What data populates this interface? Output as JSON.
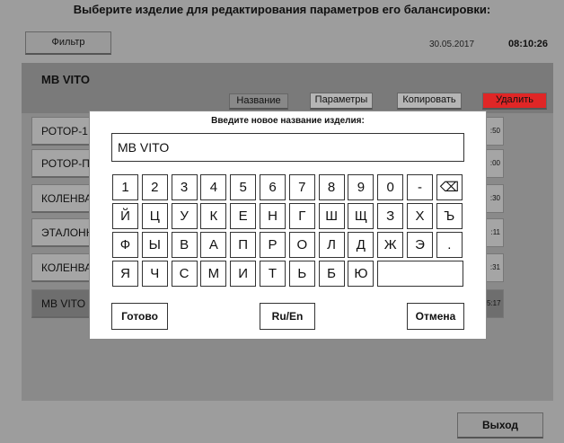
{
  "title": "Выберите изделие для редактирования параметров его балансировки:",
  "toolbar": {
    "filter_label": "Фильтр",
    "date": "30.05.2017",
    "time": "08:10:26"
  },
  "selected_item": {
    "name": "MB VITO"
  },
  "tabs": [
    "Название",
    "Параметры",
    "Копировать",
    "Удалить"
  ],
  "colors": {
    "delete_accent": "#e02626"
  },
  "list": {
    "items": [
      "РОТОР-1",
      "РОТОР-П",
      "КОЛЕНВА",
      "ЭТАЛОНН",
      "КОЛЕНВА",
      "MB VITO"
    ],
    "times": [
      ":50",
      ":00",
      ":30",
      ":11",
      ":31",
      "5:17"
    ],
    "selected_index": 5
  },
  "dialog": {
    "title": "Введите новое название изделия:",
    "input_value": "MB VITO",
    "keyboard": {
      "row1": [
        "1",
        "2",
        "3",
        "4",
        "5",
        "6",
        "7",
        "8",
        "9",
        "0",
        "-",
        "⌫"
      ],
      "row2": [
        "Й",
        "Ц",
        "У",
        "К",
        "Е",
        "Н",
        "Г",
        "Ш",
        "Щ",
        "З",
        "Х",
        "Ъ"
      ],
      "row3": [
        "Ф",
        "Ы",
        "В",
        "А",
        "П",
        "Р",
        "О",
        "Л",
        "Д",
        "Ж",
        "Э",
        "."
      ],
      "row4": [
        "Я",
        "Ч",
        "С",
        "М",
        "И",
        "Т",
        "Ь",
        "Б",
        "Ю"
      ]
    },
    "ok_label": "Готово",
    "lang_label": "Ru/En",
    "cancel_label": "Отмена"
  },
  "footer": {
    "exit_label": "Выход"
  }
}
